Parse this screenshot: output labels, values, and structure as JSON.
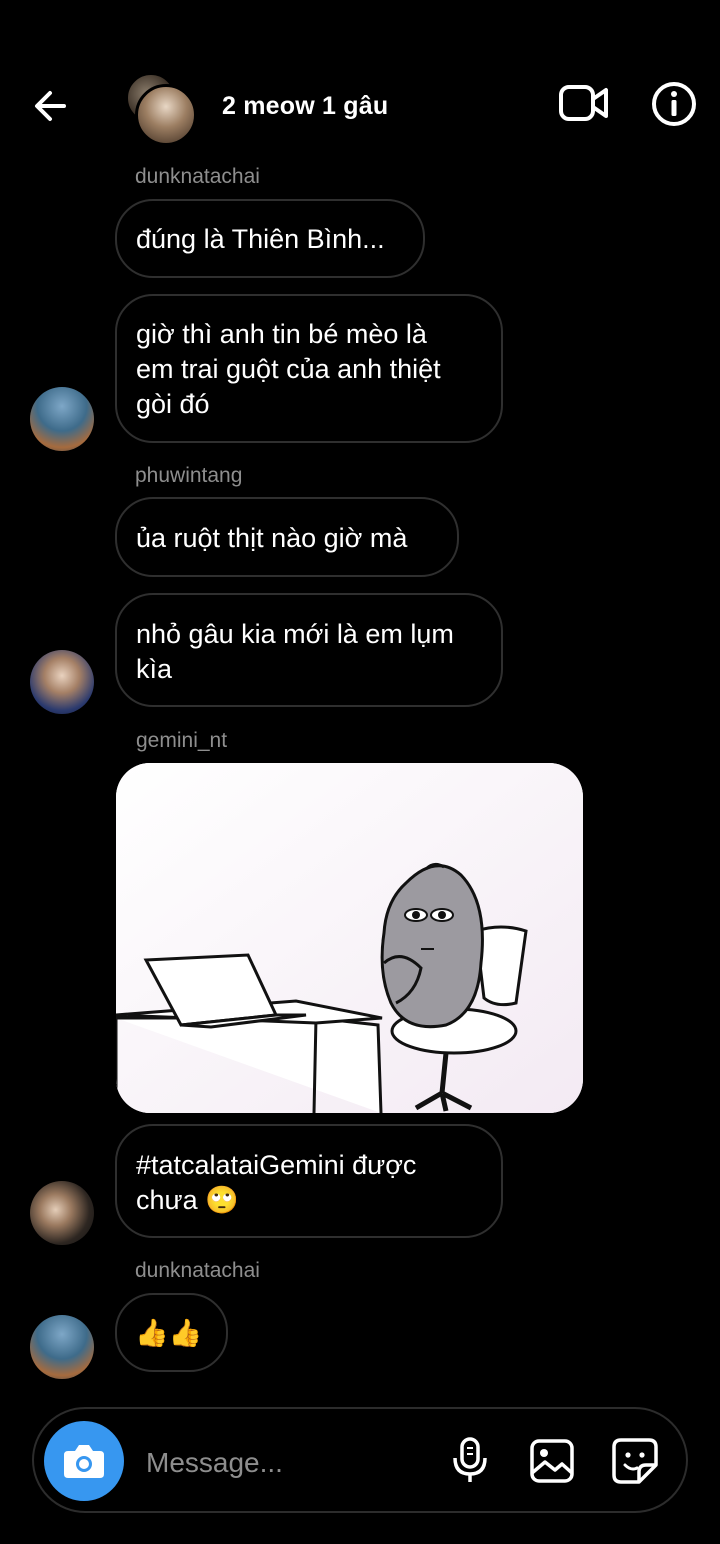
{
  "header": {
    "title": "2 meow 1 gâu",
    "back_icon": "arrow-left-icon",
    "video_icon": "video-call-icon",
    "info_icon": "info-icon"
  },
  "messages": [
    {
      "username": "dunknatachai"
    },
    {
      "text": "đúng là Thiên Bình..."
    },
    {
      "lines": [
        "giờ thì anh tin bé mèo là",
        "em trai guột của anh thiệt",
        "gòi đó"
      ]
    },
    {
      "username": "phuwintang"
    },
    {
      "text": "ủa ruột thịt nào giờ mà"
    },
    {
      "lines": [
        "nhỏ gâu kia mới là em lụm",
        "kìa"
      ]
    },
    {
      "username": "gemini_nt"
    },
    {
      "media": "sticker-image"
    },
    {
      "lines": [
        "#tatcalataiGemini được",
        "chưa 🙄"
      ]
    },
    {
      "username": "dunknatachai"
    },
    {
      "text": "👍👍"
    }
  ],
  "composer": {
    "placeholder": "Message...",
    "camera_icon": "camera-icon",
    "mic_icon": "microphone-icon",
    "gallery_icon": "image-gallery-icon",
    "sticker_icon": "sticker-icon"
  },
  "colors": {
    "background": "#000000",
    "bubble_border": "#2f2f2f",
    "username": "#8e8e8e",
    "camera_button": "#3797f0"
  }
}
